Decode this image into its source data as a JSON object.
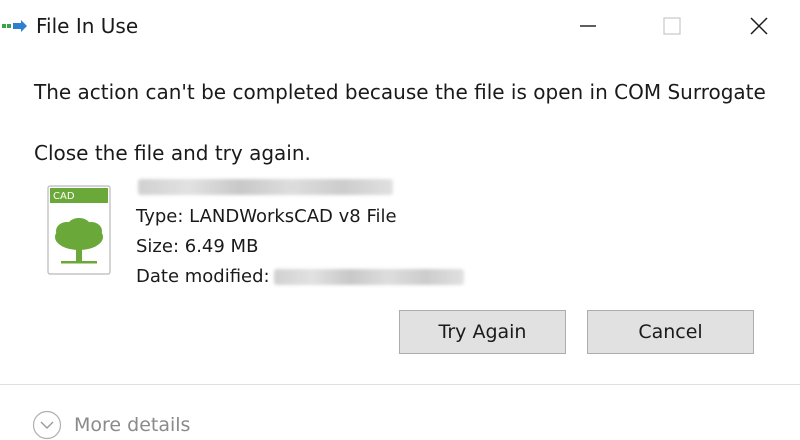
{
  "window": {
    "title": "File In Use",
    "controls": {
      "minimize": "minimize",
      "maximize": "maximize",
      "close": "close"
    }
  },
  "dialog": {
    "message": "The action can't be completed because the file is open in COM Surrogate",
    "instruction": "Close the file and try again."
  },
  "file": {
    "icon_badge": "CAD",
    "icon": "tree-document-icon",
    "type_label": "Type: LANDWorksCAD v8 File",
    "size_label": "Size: 6.49 MB",
    "date_label": "Date modified:"
  },
  "buttons": {
    "try_again": "Try Again",
    "cancel": "Cancel"
  },
  "footer": {
    "more_details": "More details"
  },
  "colors": {
    "background": "#ffffff",
    "button_bg": "#e1e1e1",
    "button_border": "#adadad",
    "icon_green": "#6aa83a",
    "muted_text": "#8a8a8a"
  }
}
